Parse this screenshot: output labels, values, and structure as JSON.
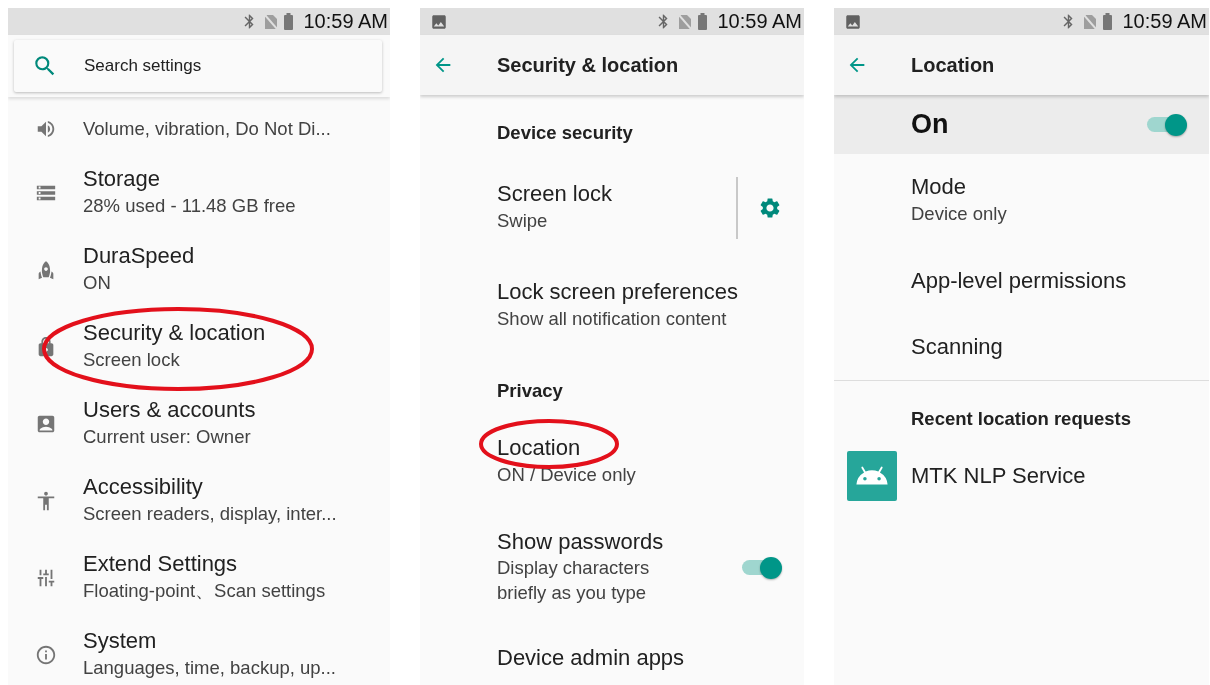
{
  "panels": [
    {
      "kind": "home",
      "status_bar": {
        "time": "10:59 AM"
      },
      "search": {
        "placeholder": "Search settings"
      },
      "items": [
        {
          "summary": "Volume, vibration, Do Not Di...",
          "circled": false
        },
        {
          "title": "Storage",
          "summary": "28% used - 11.48 GB free",
          "circled": false
        },
        {
          "title": "DuraSpeed",
          "summary": "ON",
          "circled": false
        },
        {
          "title": "Security & location",
          "summary": "Screen lock",
          "circled": true
        },
        {
          "title": "Users & accounts",
          "summary": "Current user: Owner",
          "circled": false
        },
        {
          "title": "Accessibility",
          "summary": "Screen readers, display, inter...",
          "circled": false
        },
        {
          "title": "Extend Settings",
          "summary": "Floating-point、Scan settings",
          "circled": false
        },
        {
          "title": "System",
          "summary": "Languages, time, backup, up...",
          "circled": false
        }
      ]
    },
    {
      "kind": "sub",
      "status_bar": {
        "time": "10:59 AM",
        "notification_icon": true
      },
      "header": {
        "title": "Security & location"
      },
      "groups": [
        {
          "heading": "Device security",
          "items": [
            {
              "kind": "gear",
              "title": "Screen lock",
              "summary": "Swipe",
              "circled": false
            },
            {
              "kind": "plain",
              "title": "Lock screen preferences",
              "summary": "Show all notification content",
              "circled": false
            }
          ]
        },
        {
          "heading": "Privacy",
          "items": [
            {
              "kind": "plain",
              "title": "Location",
              "summary": "ON / Device only",
              "circled": true
            },
            {
              "kind": "switch",
              "title": "Show passwords",
              "summary": "Display characters briefly as you type",
              "on": true,
              "circled": false
            }
          ]
        },
        {
          "items": [
            {
              "kind": "plain",
              "title": "Device admin apps",
              "circled": false
            }
          ]
        }
      ]
    },
    {
      "kind": "sub",
      "status_bar": {
        "time": "10:59 AM",
        "notification_icon": true
      },
      "header": {
        "title": "Location"
      },
      "master": {
        "label": "On",
        "on": true
      },
      "groups": [
        {
          "items": [
            {
              "kind": "plain",
              "title": "Mode",
              "summary": "Device only",
              "circled": false
            },
            {
              "kind": "plain",
              "title": "App-level permissions",
              "circled": false
            },
            {
              "kind": "plain",
              "title": "Scanning",
              "circled": false
            }
          ]
        },
        {
          "heading": "Recent location requests",
          "items": [
            {
              "kind": "app",
              "title": "MTK NLP Service"
            }
          ]
        }
      ]
    }
  ]
}
